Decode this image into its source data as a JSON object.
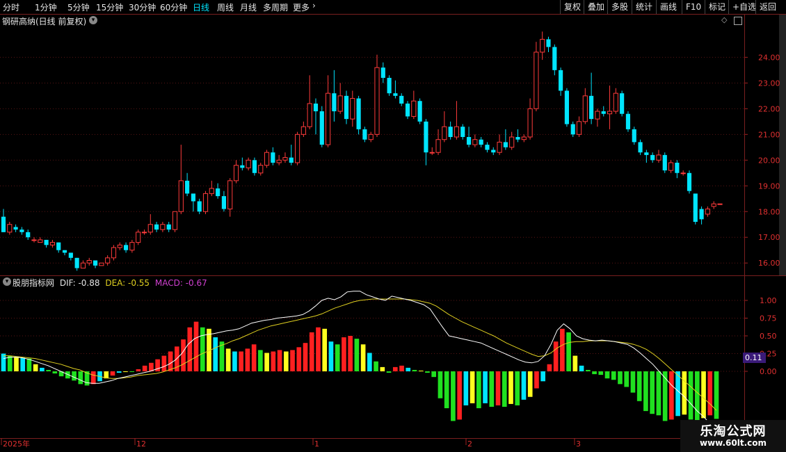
{
  "toolbar": {
    "periods": [
      "分时",
      "1分钟",
      "5分钟",
      "15分钟",
      "30分钟",
      "60分钟",
      "日线",
      "周线",
      "月线",
      "多周期",
      "更多"
    ],
    "active_period": "日线",
    "right_buttons": [
      "复权",
      "叠加",
      "多股",
      "统计",
      "画线",
      "F10",
      "标记",
      "+自选",
      "返回"
    ]
  },
  "main_chart": {
    "stock_label": "钢研高纳(日线 前复权)",
    "y_ticks": [
      "24.00",
      "23.00",
      "22.00",
      "21.00",
      "20.00",
      "19.00",
      "18.00",
      "17.00",
      "16.00"
    ]
  },
  "indicator": {
    "name": "股朋指标网",
    "dif_label": "DIF: -0.88",
    "dea_label": "DEA: -0.55",
    "macd_label": "MACD: -0.67",
    "y_ticks": [
      "1.00",
      "0.75",
      "0.50",
      "0.25",
      "0.00"
    ],
    "badge": "0.11"
  },
  "x_axis": {
    "labels": [
      "2025年",
      "12",
      "1",
      "2",
      "3"
    ]
  },
  "watermark": {
    "title": "乐淘公式网",
    "url": "www.60lt.com"
  },
  "chart_data": {
    "type": "candlestick",
    "y_range": [
      15.6,
      25.2
    ],
    "candles": [
      [
        17.8,
        17.2,
        17.2,
        18.1
      ],
      [
        17.2,
        17.5,
        17.1,
        17.6
      ],
      [
        17.4,
        17.3,
        17.2,
        17.5
      ],
      [
        17.3,
        17.2,
        17.1,
        17.4
      ],
      [
        17.2,
        17.0,
        16.9,
        17.3
      ],
      [
        16.9,
        16.9,
        16.8,
        17.0
      ],
      [
        16.8,
        16.9,
        16.8,
        17.0
      ],
      [
        16.9,
        16.7,
        16.6,
        16.9
      ],
      [
        16.7,
        16.8,
        16.6,
        16.9
      ],
      [
        16.8,
        16.5,
        16.4,
        16.8
      ],
      [
        16.5,
        16.4,
        16.3,
        16.5
      ],
      [
        16.4,
        16.2,
        16.1,
        16.4
      ],
      [
        16.2,
        15.8,
        15.7,
        16.2
      ],
      [
        15.8,
        16.0,
        15.8,
        16.1
      ],
      [
        16.0,
        16.1,
        15.9,
        16.2
      ],
      [
        16.1,
        15.9,
        15.8,
        16.1
      ],
      [
        15.9,
        16.0,
        15.9,
        16.0
      ],
      [
        16.0,
        16.2,
        15.9,
        16.3
      ],
      [
        16.2,
        16.6,
        16.1,
        16.7
      ],
      [
        16.6,
        16.7,
        16.5,
        16.8
      ],
      [
        16.7,
        16.5,
        16.4,
        16.8
      ],
      [
        16.5,
        16.8,
        16.4,
        16.9
      ],
      [
        16.8,
        17.2,
        16.7,
        17.3
      ],
      [
        17.2,
        17.2,
        17.1,
        17.3
      ],
      [
        17.2,
        17.5,
        17.1,
        17.9
      ],
      [
        17.5,
        17.3,
        17.2,
        17.6
      ],
      [
        17.3,
        17.5,
        17.2,
        17.6
      ],
      [
        17.5,
        17.3,
        17.2,
        17.6
      ],
      [
        17.3,
        18.0,
        17.2,
        18.0
      ],
      [
        18.0,
        19.2,
        17.9,
        20.6
      ],
      [
        19.2,
        18.7,
        18.6,
        19.5
      ],
      [
        18.7,
        18.4,
        18.0,
        18.6
      ],
      [
        18.4,
        18.0,
        17.9,
        18.5
      ],
      [
        18.0,
        18.7,
        17.9,
        18.8
      ],
      [
        18.7,
        18.9,
        18.6,
        19.2
      ],
      [
        18.9,
        18.6,
        18.5,
        19.1
      ],
      [
        18.6,
        18.1,
        18.0,
        18.8
      ],
      [
        18.1,
        19.2,
        17.8,
        19.3
      ],
      [
        19.2,
        19.8,
        19.1,
        20.0
      ],
      [
        19.8,
        19.7,
        19.6,
        20.1
      ],
      [
        19.7,
        20.0,
        19.6,
        20.1
      ],
      [
        20.0,
        19.5,
        19.4,
        20.1
      ],
      [
        19.5,
        19.8,
        19.4,
        19.9
      ],
      [
        19.8,
        20.3,
        19.7,
        20.4
      ],
      [
        20.3,
        19.9,
        19.8,
        20.5
      ],
      [
        19.9,
        20.0,
        19.8,
        20.2
      ],
      [
        20.0,
        20.1,
        19.9,
        20.3
      ],
      [
        20.1,
        19.9,
        19.8,
        20.6
      ],
      [
        19.9,
        21.0,
        19.8,
        21.1
      ],
      [
        21.0,
        21.3,
        20.9,
        21.5
      ],
      [
        21.3,
        22.2,
        21.2,
        23.3
      ],
      [
        22.2,
        21.9,
        21.0,
        22.4
      ],
      [
        21.9,
        20.6,
        20.5,
        22.1
      ],
      [
        20.6,
        22.6,
        20.5,
        23.3
      ],
      [
        22.6,
        21.9,
        21.5,
        23.5
      ],
      [
        21.9,
        22.5,
        21.8,
        23.0
      ],
      [
        22.5,
        21.6,
        21.4,
        22.7
      ],
      [
        21.6,
        22.4,
        21.3,
        22.7
      ],
      [
        22.4,
        21.2,
        21.0,
        22.5
      ],
      [
        21.2,
        20.8,
        20.7,
        21.3
      ],
      [
        20.8,
        21.0,
        20.7,
        21.1
      ],
      [
        21.0,
        23.6,
        20.9,
        24.1
      ],
      [
        23.6,
        23.2,
        23.0,
        23.8
      ],
      [
        23.2,
        22.6,
        22.5,
        23.3
      ],
      [
        22.6,
        22.5,
        22.4,
        23.1
      ],
      [
        22.5,
        22.2,
        22.1,
        22.6
      ],
      [
        22.2,
        21.7,
        21.6,
        22.3
      ],
      [
        21.7,
        22.3,
        21.6,
        22.7
      ],
      [
        22.3,
        21.5,
        21.4,
        22.4
      ],
      [
        21.5,
        20.3,
        19.8,
        21.6
      ],
      [
        20.3,
        20.3,
        20.2,
        20.5
      ],
      [
        20.3,
        20.8,
        20.2,
        21.2
      ],
      [
        20.8,
        21.3,
        20.7,
        21.9
      ],
      [
        21.3,
        20.9,
        20.8,
        21.5
      ],
      [
        20.9,
        21.3,
        20.8,
        22.3
      ],
      [
        21.3,
        20.9,
        20.8,
        21.4
      ],
      [
        20.9,
        20.6,
        20.5,
        21.3
      ],
      [
        20.6,
        20.8,
        20.5,
        21.0
      ],
      [
        20.8,
        20.6,
        20.5,
        20.9
      ],
      [
        20.6,
        20.4,
        20.3,
        20.7
      ],
      [
        20.4,
        20.3,
        20.2,
        20.5
      ],
      [
        20.3,
        20.7,
        20.2,
        21.0
      ],
      [
        20.7,
        20.5,
        20.4,
        21.2
      ],
      [
        20.5,
        20.9,
        20.4,
        21.1
      ],
      [
        20.9,
        20.8,
        20.7,
        21.2
      ],
      [
        20.8,
        20.9,
        20.7,
        21.0
      ],
      [
        20.9,
        22.0,
        20.8,
        22.4
      ],
      [
        22.0,
        24.2,
        21.9,
        24.6
      ],
      [
        24.2,
        24.7,
        23.9,
        25.0
      ],
      [
        24.7,
        24.4,
        24.2,
        24.8
      ],
      [
        24.4,
        23.5,
        23.3,
        24.5
      ],
      [
        23.5,
        22.7,
        22.5,
        23.6
      ],
      [
        22.7,
        21.4,
        21.3,
        22.8
      ],
      [
        21.4,
        21.0,
        20.9,
        21.5
      ],
      [
        21.0,
        21.5,
        20.9,
        21.7
      ],
      [
        21.5,
        22.5,
        21.4,
        22.8
      ],
      [
        22.5,
        21.6,
        21.4,
        23.4
      ],
      [
        21.6,
        21.9,
        21.3,
        22.0
      ],
      [
        21.9,
        21.8,
        21.7,
        22.1
      ],
      [
        21.8,
        21.9,
        21.2,
        22.9
      ],
      [
        21.9,
        22.6,
        21.8,
        22.8
      ],
      [
        22.6,
        21.8,
        21.7,
        22.7
      ],
      [
        21.8,
        21.2,
        21.1,
        21.9
      ],
      [
        21.2,
        20.7,
        20.6,
        21.3
      ],
      [
        20.7,
        20.3,
        20.2,
        20.8
      ],
      [
        20.3,
        20.2,
        19.9,
        20.4
      ],
      [
        20.2,
        20.0,
        19.9,
        20.3
      ],
      [
        20.0,
        20.2,
        19.9,
        20.4
      ],
      [
        20.2,
        19.6,
        19.5,
        20.3
      ],
      [
        19.6,
        19.9,
        19.5,
        20.0
      ],
      [
        19.9,
        19.5,
        19.3,
        20.0
      ],
      [
        19.5,
        19.5,
        19.4,
        19.6
      ],
      [
        19.5,
        18.8,
        18.7,
        19.6
      ],
      [
        18.7,
        17.6,
        17.5,
        18.5
      ],
      [
        18.1,
        17.7,
        17.5,
        18.2
      ],
      [
        17.9,
        18.1,
        17.8,
        18.2
      ],
      [
        18.2,
        18.3,
        18.1,
        18.4
      ],
      [
        18.3,
        18.3,
        18.3,
        18.3
      ]
    ],
    "macd_hist": [
      0.25,
      0.22,
      0.2,
      0.19,
      0.18,
      0.1,
      0.05,
      0.02,
      -0.03,
      -0.07,
      -0.1,
      -0.13,
      -0.18,
      -0.2,
      -0.18,
      -0.14,
      -0.1,
      -0.06,
      -0.02,
      -0.01,
      -0.01,
      0.03,
      0.08,
      0.12,
      0.17,
      0.22,
      0.28,
      0.35,
      0.45,
      0.62,
      0.7,
      0.62,
      0.6,
      0.48,
      0.42,
      0.32,
      0.28,
      0.28,
      0.32,
      0.38,
      0.3,
      0.26,
      0.28,
      0.3,
      0.28,
      0.3,
      0.34,
      0.4,
      0.55,
      0.62,
      0.6,
      0.42,
      0.38,
      0.48,
      0.5,
      0.46,
      0.38,
      0.26,
      0.14,
      0.06,
      -0.02,
      0.06,
      0.08,
      0.05,
      0.02,
      0.01,
      -0.02,
      -0.08,
      -0.38,
      -0.52,
      -0.7,
      -0.68,
      -0.48,
      -0.45,
      -0.52,
      -0.45,
      -0.5,
      -0.48,
      -0.5,
      -0.46,
      -0.48,
      -0.4,
      -0.36,
      -0.24,
      -0.14,
      0.1,
      0.42,
      0.6,
      0.55,
      0.22,
      0.08,
      0.02,
      -0.04,
      -0.05,
      -0.1,
      -0.12,
      -0.18,
      -0.22,
      -0.3,
      -0.42,
      -0.56,
      -0.6,
      -0.62,
      -0.7,
      -0.68,
      -0.63,
      -0.61,
      -0.68,
      -0.72,
      -0.66,
      -0.62,
      -0.67
    ],
    "dif": [
      0.18,
      0.2,
      0.2,
      0.19,
      0.17,
      0.14,
      0.11,
      0.08,
      0.04,
      0.0,
      -0.04,
      -0.08,
      -0.12,
      -0.16,
      -0.17,
      -0.17,
      -0.15,
      -0.13,
      -0.1,
      -0.08,
      -0.06,
      -0.04,
      -0.02,
      0.0,
      0.03,
      0.06,
      0.1,
      0.16,
      0.25,
      0.38,
      0.46,
      0.5,
      0.52,
      0.53,
      0.55,
      0.57,
      0.58,
      0.6,
      0.64,
      0.68,
      0.7,
      0.72,
      0.73,
      0.75,
      0.76,
      0.77,
      0.78,
      0.8,
      0.85,
      0.92,
      1.0,
      1.03,
      1.01,
      1.05,
      1.12,
      1.13,
      1.13,
      1.08,
      1.05,
      1.02,
      1.0,
      1.06,
      1.04,
      1.02,
      1.0,
      0.97,
      0.94,
      0.88,
      0.75,
      0.62,
      0.5,
      0.48,
      0.46,
      0.44,
      0.42,
      0.4,
      0.36,
      0.32,
      0.28,
      0.24,
      0.2,
      0.16,
      0.13,
      0.12,
      0.14,
      0.22,
      0.38,
      0.58,
      0.67,
      0.6,
      0.5,
      0.46,
      0.44,
      0.43,
      0.44,
      0.43,
      0.42,
      0.4,
      0.38,
      0.33,
      0.26,
      0.18,
      0.1,
      0.0,
      -0.1,
      -0.2,
      -0.28,
      -0.36,
      -0.46,
      -0.56,
      -0.64,
      -0.74,
      -0.88
    ],
    "dea": [
      0.22,
      0.22,
      0.21,
      0.2,
      0.19,
      0.18,
      0.16,
      0.14,
      0.12,
      0.1,
      0.07,
      0.04,
      0.02,
      -0.02,
      -0.05,
      -0.07,
      -0.09,
      -0.1,
      -0.1,
      -0.09,
      -0.08,
      -0.06,
      -0.05,
      -0.04,
      -0.03,
      -0.01,
      0.02,
      0.05,
      0.09,
      0.14,
      0.19,
      0.24,
      0.28,
      0.32,
      0.36,
      0.39,
      0.43,
      0.46,
      0.5,
      0.54,
      0.58,
      0.61,
      0.64,
      0.66,
      0.68,
      0.7,
      0.72,
      0.74,
      0.76,
      0.78,
      0.81,
      0.85,
      0.89,
      0.92,
      0.95,
      0.98,
      1.0,
      1.01,
      1.02,
      1.02,
      1.02,
      1.02,
      1.02,
      1.02,
      1.01,
      1.0,
      0.98,
      0.96,
      0.92,
      0.86,
      0.8,
      0.75,
      0.7,
      0.66,
      0.62,
      0.58,
      0.54,
      0.5,
      0.45,
      0.4,
      0.36,
      0.32,
      0.28,
      0.24,
      0.21,
      0.22,
      0.26,
      0.33,
      0.38,
      0.41,
      0.42,
      0.42,
      0.43,
      0.43,
      0.43,
      0.43,
      0.42,
      0.41,
      0.4,
      0.38,
      0.35,
      0.31,
      0.25,
      0.18,
      0.1,
      0.02,
      -0.06,
      -0.14,
      -0.22,
      -0.3,
      -0.38,
      -0.46,
      -0.55
    ]
  }
}
